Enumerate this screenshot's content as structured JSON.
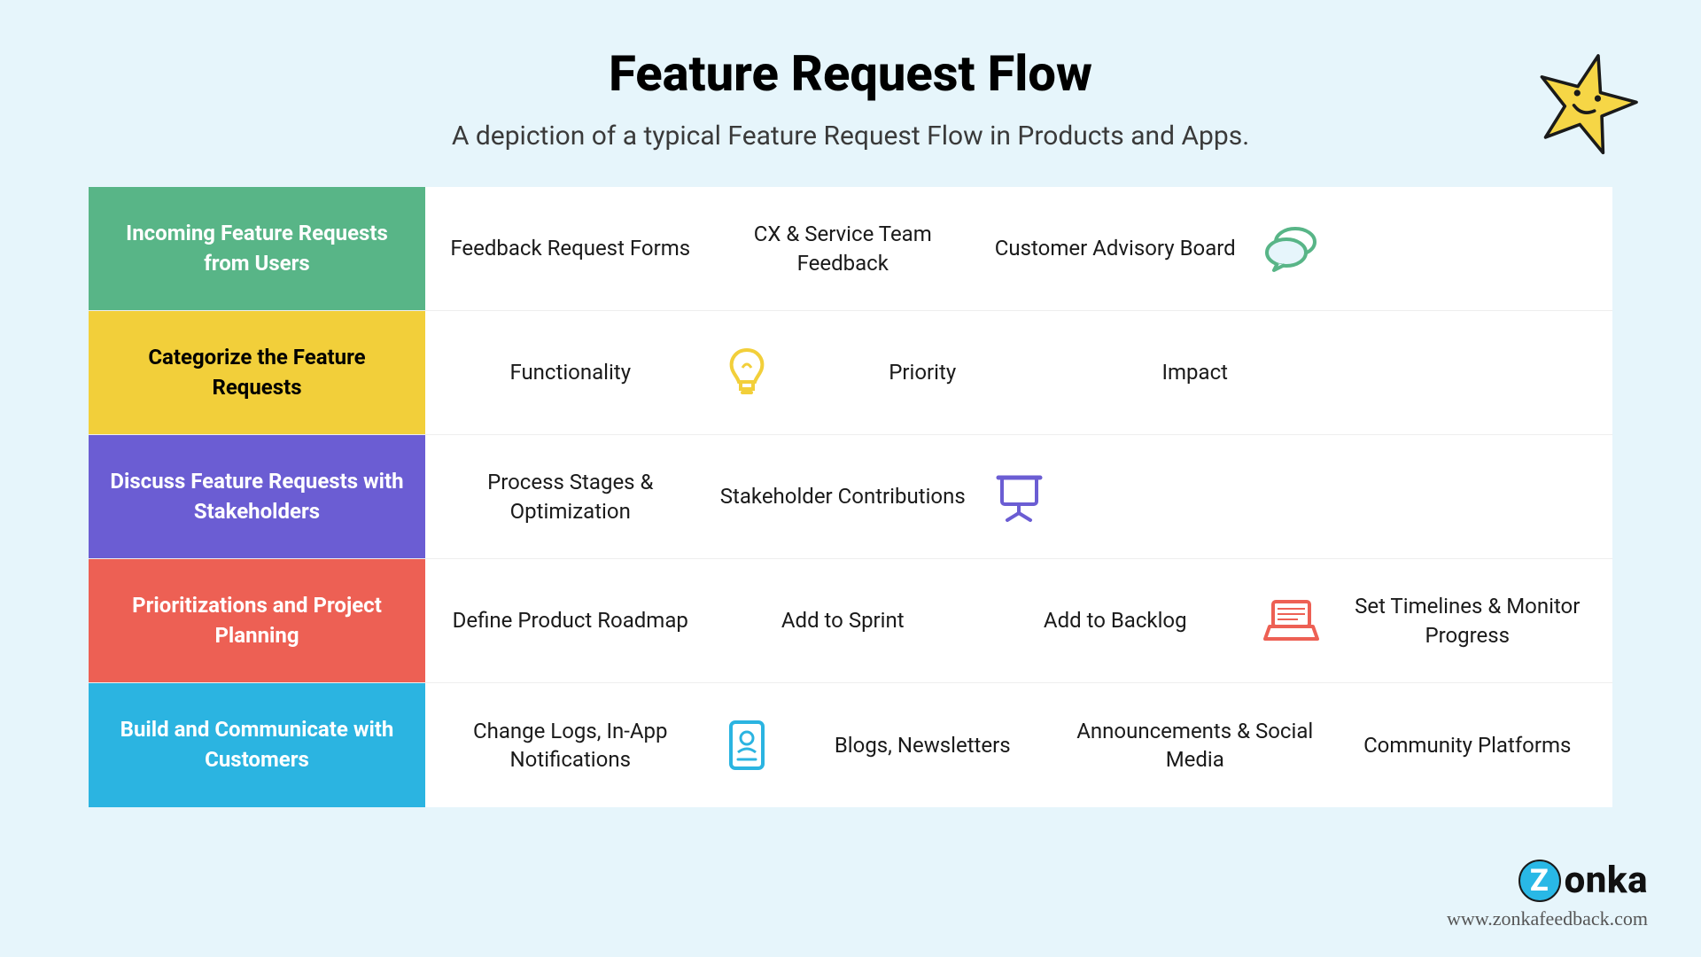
{
  "title": "Feature Request Flow",
  "subtitle": "A depiction of a typical Feature Request Flow in Products and Apps.",
  "rows": [
    {
      "color": "green",
      "label": "Incoming Feature Requests from Users",
      "items": [
        "Feedback Request Forms",
        "CX & Service Team Feedback",
        "Customer Advisory Board"
      ],
      "icon": "chat-icon",
      "icon_after": 3
    },
    {
      "color": "yellow",
      "label": "Categorize the Feature Requests",
      "items": [
        "Functionality",
        "Priority",
        "Impact"
      ],
      "icon": "lightbulb-icon",
      "icon_after": 1
    },
    {
      "color": "purple",
      "label": "Discuss Feature Requests with Stakeholders",
      "items": [
        "Process Stages & Optimization",
        "Stakeholder Contributions"
      ],
      "icon": "presentation-icon",
      "icon_after": 2
    },
    {
      "color": "red",
      "label": "Prioritizations and Project Planning",
      "items": [
        "Define Product Roadmap",
        "Add to Sprint",
        "Add to Backlog",
        "Set Timelines & Monitor Progress"
      ],
      "icon": "laptop-icon",
      "icon_after": 3
    },
    {
      "color": "blue",
      "label": "Build and Communicate with Customers",
      "items": [
        "Change Logs, In-App Notifications",
        "Blogs, Newsletters",
        "Announcements & Social Media",
        "Community Platforms"
      ],
      "icon": "id-card-icon",
      "icon_after": 1
    }
  ],
  "brand": "onka",
  "brand_letter": "Z",
  "url": "www.zonkafeedback.com"
}
